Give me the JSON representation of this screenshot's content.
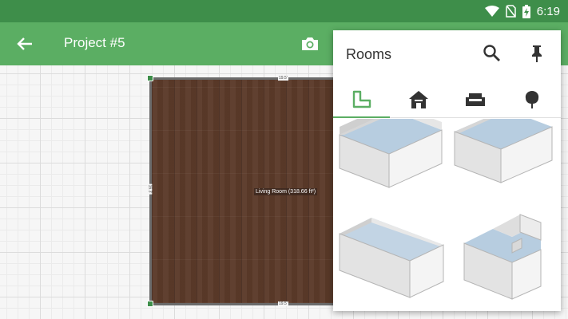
{
  "status_bar": {
    "time": "6:19",
    "icons": [
      "wifi-icon",
      "no-sim-icon",
      "battery-charging-icon"
    ]
  },
  "app_bar": {
    "title": "Project #5",
    "back_icon": "arrow-back-icon",
    "camera_icon": "camera-icon"
  },
  "floor_plan": {
    "room_label": "Living Room (318.66 ft²)",
    "dim_top": "19.5'",
    "dim_bottom": "19.5'",
    "dim_left": "16.3'"
  },
  "rooms_panel": {
    "title": "Rooms",
    "search_icon": "search-icon",
    "pin_icon": "pin-icon",
    "tabs": [
      {
        "icon": "l-shape-icon",
        "active": true
      },
      {
        "icon": "house-icon",
        "active": false
      },
      {
        "icon": "sofa-icon",
        "active": false
      },
      {
        "icon": "tree-icon",
        "active": false
      }
    ],
    "items": [
      {
        "icon": "square-room-icon"
      },
      {
        "icon": "square-room-icon"
      },
      {
        "icon": "rectangle-room-icon"
      },
      {
        "icon": "l-shaped-room-icon"
      }
    ]
  },
  "colors": {
    "status_bar": "#3e8e4a",
    "app_bar": "#5bae63",
    "accent": "#5bae63",
    "floor": "#5b3a29"
  }
}
